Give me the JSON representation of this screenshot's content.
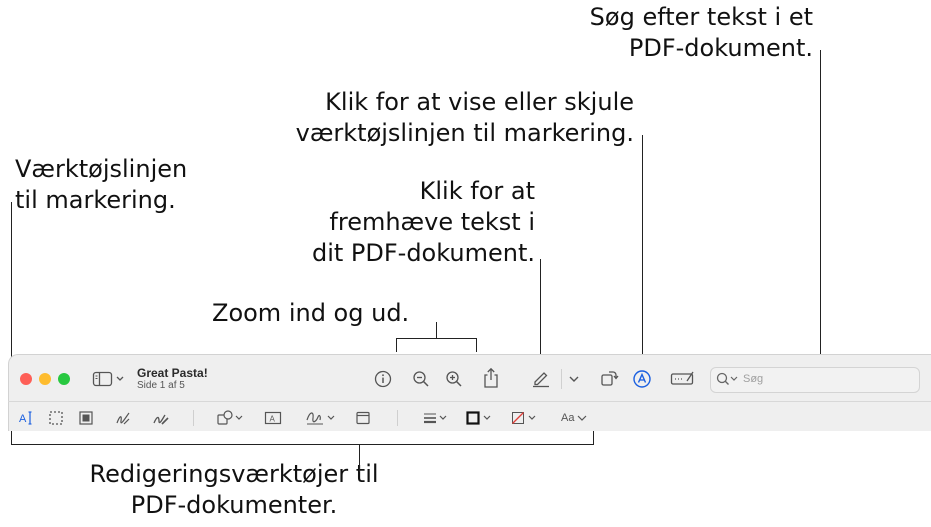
{
  "window": {
    "title": "Great Pasta!",
    "subtitle": "Side 1 af 5",
    "search_placeholder": "Søg",
    "colors": {
      "close": "#fe5f57",
      "minimize": "#febc2e",
      "zoom": "#28c840",
      "accent": "#1a5fe0"
    }
  },
  "toolbar_main": [
    "sidebar-toggle-icon",
    "info-icon",
    "zoom-out-icon",
    "zoom-in-icon",
    "share-icon",
    "highlight-pen-icon",
    "chevron-down-icon",
    "rotate-icon",
    "markup-toolbar-icon",
    "form-fill-icon",
    "search-icon"
  ],
  "toolbar_markup": [
    "text-selection-icon",
    "rectangular-selection-icon",
    "redact-icon",
    "sketch-icon",
    "draw-icon",
    "shapes-icon",
    "text-box-icon",
    "sign-icon",
    "note-icon",
    "shape-style-icon",
    "border-color-icon",
    "fill-color-icon",
    "text-style-icon"
  ],
  "callouts": {
    "search": [
      "Søg efter tekst i et",
      "PDF-dokument."
    ],
    "toggle_markup": [
      "Klik for at vise eller skjule",
      "værktøjslinjen til markering."
    ],
    "markup_toolbar": [
      "Værktøjslinjen",
      "til markering."
    ],
    "highlight": [
      "Klik for at",
      "fremhæve tekst i",
      "dit PDF-dokument."
    ],
    "zoom": [
      "Zoom ind og ud."
    ],
    "editing_tools": [
      "Redigeringsværktøjer til",
      "PDF-dokumenter."
    ]
  },
  "text_style_label": "Aa"
}
